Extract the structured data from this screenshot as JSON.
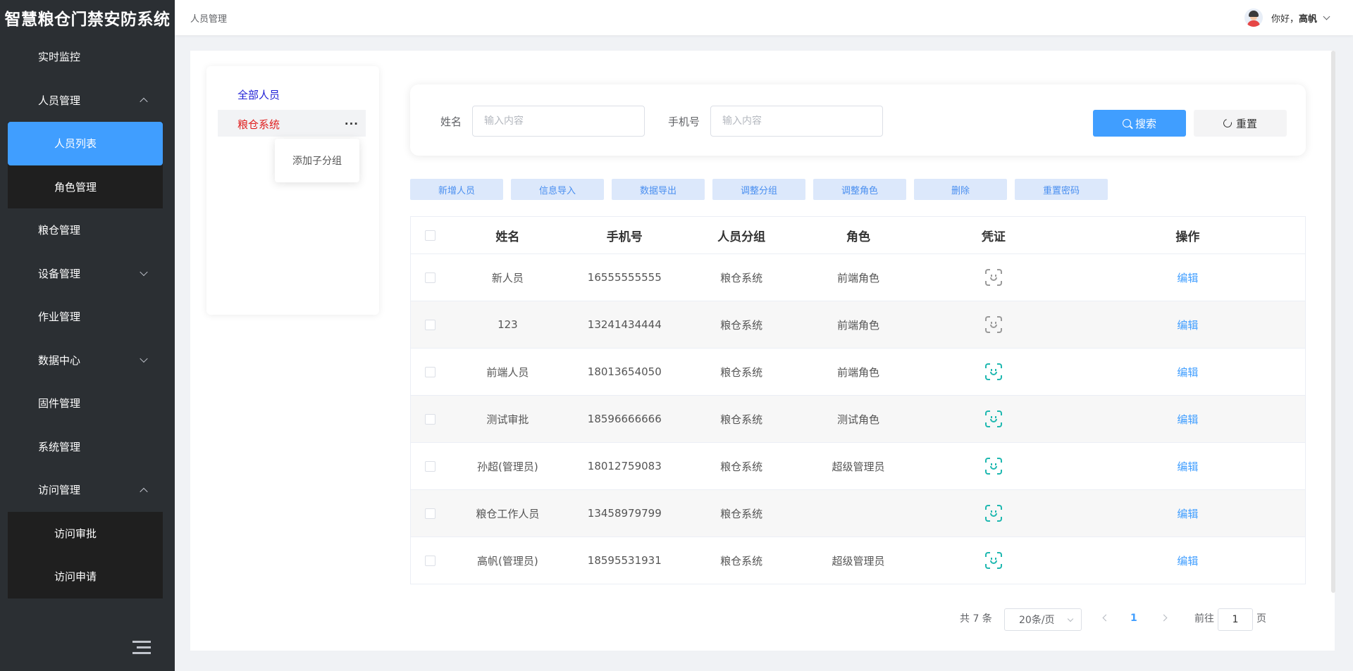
{
  "app": {
    "title": "智慧粮仓门禁安防系统"
  },
  "sidebar": {
    "items": [
      {
        "label": "实时监控"
      },
      {
        "label": "人员管理"
      },
      {
        "label": "粮仓管理"
      },
      {
        "label": "设备管理"
      },
      {
        "label": "作业管理"
      },
      {
        "label": "数据中心"
      },
      {
        "label": "固件管理"
      },
      {
        "label": "系统管理"
      },
      {
        "label": "访问管理"
      }
    ],
    "personnel_sub": [
      {
        "label": "人员列表"
      },
      {
        "label": "角色管理"
      }
    ],
    "visit_sub": [
      {
        "label": "访问审批"
      },
      {
        "label": "访问申请"
      }
    ]
  },
  "header": {
    "breadcrumb": "人员管理",
    "user": {
      "greeting": "你好，",
      "name": "高帆"
    }
  },
  "tree": {
    "all": "全部人员",
    "selected": "粮仓系统",
    "more": "···",
    "popover": "添加子分组"
  },
  "search": {
    "name_label": "姓名",
    "name_placeholder": "输入内容",
    "phone_label": "手机号",
    "phone_placeholder": "输入内容",
    "search_btn": "搜索",
    "reset_btn": "重置"
  },
  "toolbar": [
    "新增人员",
    "信息导入",
    "数据导出",
    "调整分组",
    "调整角色",
    "删除",
    "重置密码"
  ],
  "table": {
    "columns": [
      "姓名",
      "手机号",
      "人员分组",
      "角色",
      "凭证",
      "操作"
    ],
    "rows": [
      {
        "name": "新人员",
        "phone": "16555555555",
        "group": "粮仓系统",
        "role": "前端角色",
        "credential": "face-outline",
        "action": "编辑"
      },
      {
        "name": "123",
        "phone": "13241434444",
        "group": "粮仓系统",
        "role": "前端角色",
        "credential": "face-outline",
        "action": "编辑"
      },
      {
        "name": "前端人员",
        "phone": "18013654050",
        "group": "粮仓系统",
        "role": "前端角色",
        "credential": "face-enrolled",
        "action": "编辑"
      },
      {
        "name": "测试审批",
        "phone": "18596666666",
        "group": "粮仓系统",
        "role": "测试角色",
        "credential": "face-enrolled",
        "action": "编辑"
      },
      {
        "name": "孙超(管理员)",
        "phone": "18012759083",
        "group": "粮仓系统",
        "role": "超级管理员",
        "credential": "face-enrolled",
        "action": "编辑"
      },
      {
        "name": "粮仓工作人员",
        "phone": "13458979799",
        "group": "粮仓系统",
        "role": "",
        "credential": "face-enrolled",
        "action": "编辑"
      },
      {
        "name": "高帆(管理员)",
        "phone": "18595531931",
        "group": "粮仓系统",
        "role": "超级管理员",
        "credential": "face-enrolled",
        "action": "编辑"
      }
    ]
  },
  "pagination": {
    "total": "共 7 条",
    "page_size": "20条/页",
    "current_page": "1",
    "goto_label": "前往",
    "goto_value": "1",
    "page_suffix": "页"
  },
  "colors": {
    "primary": "#409eff",
    "sidebar_bg": "#2b2f33",
    "tree_selected_text": "#e02020",
    "face_enrolled": "#1fb8b0",
    "face_outline": "#9a9a9a"
  }
}
